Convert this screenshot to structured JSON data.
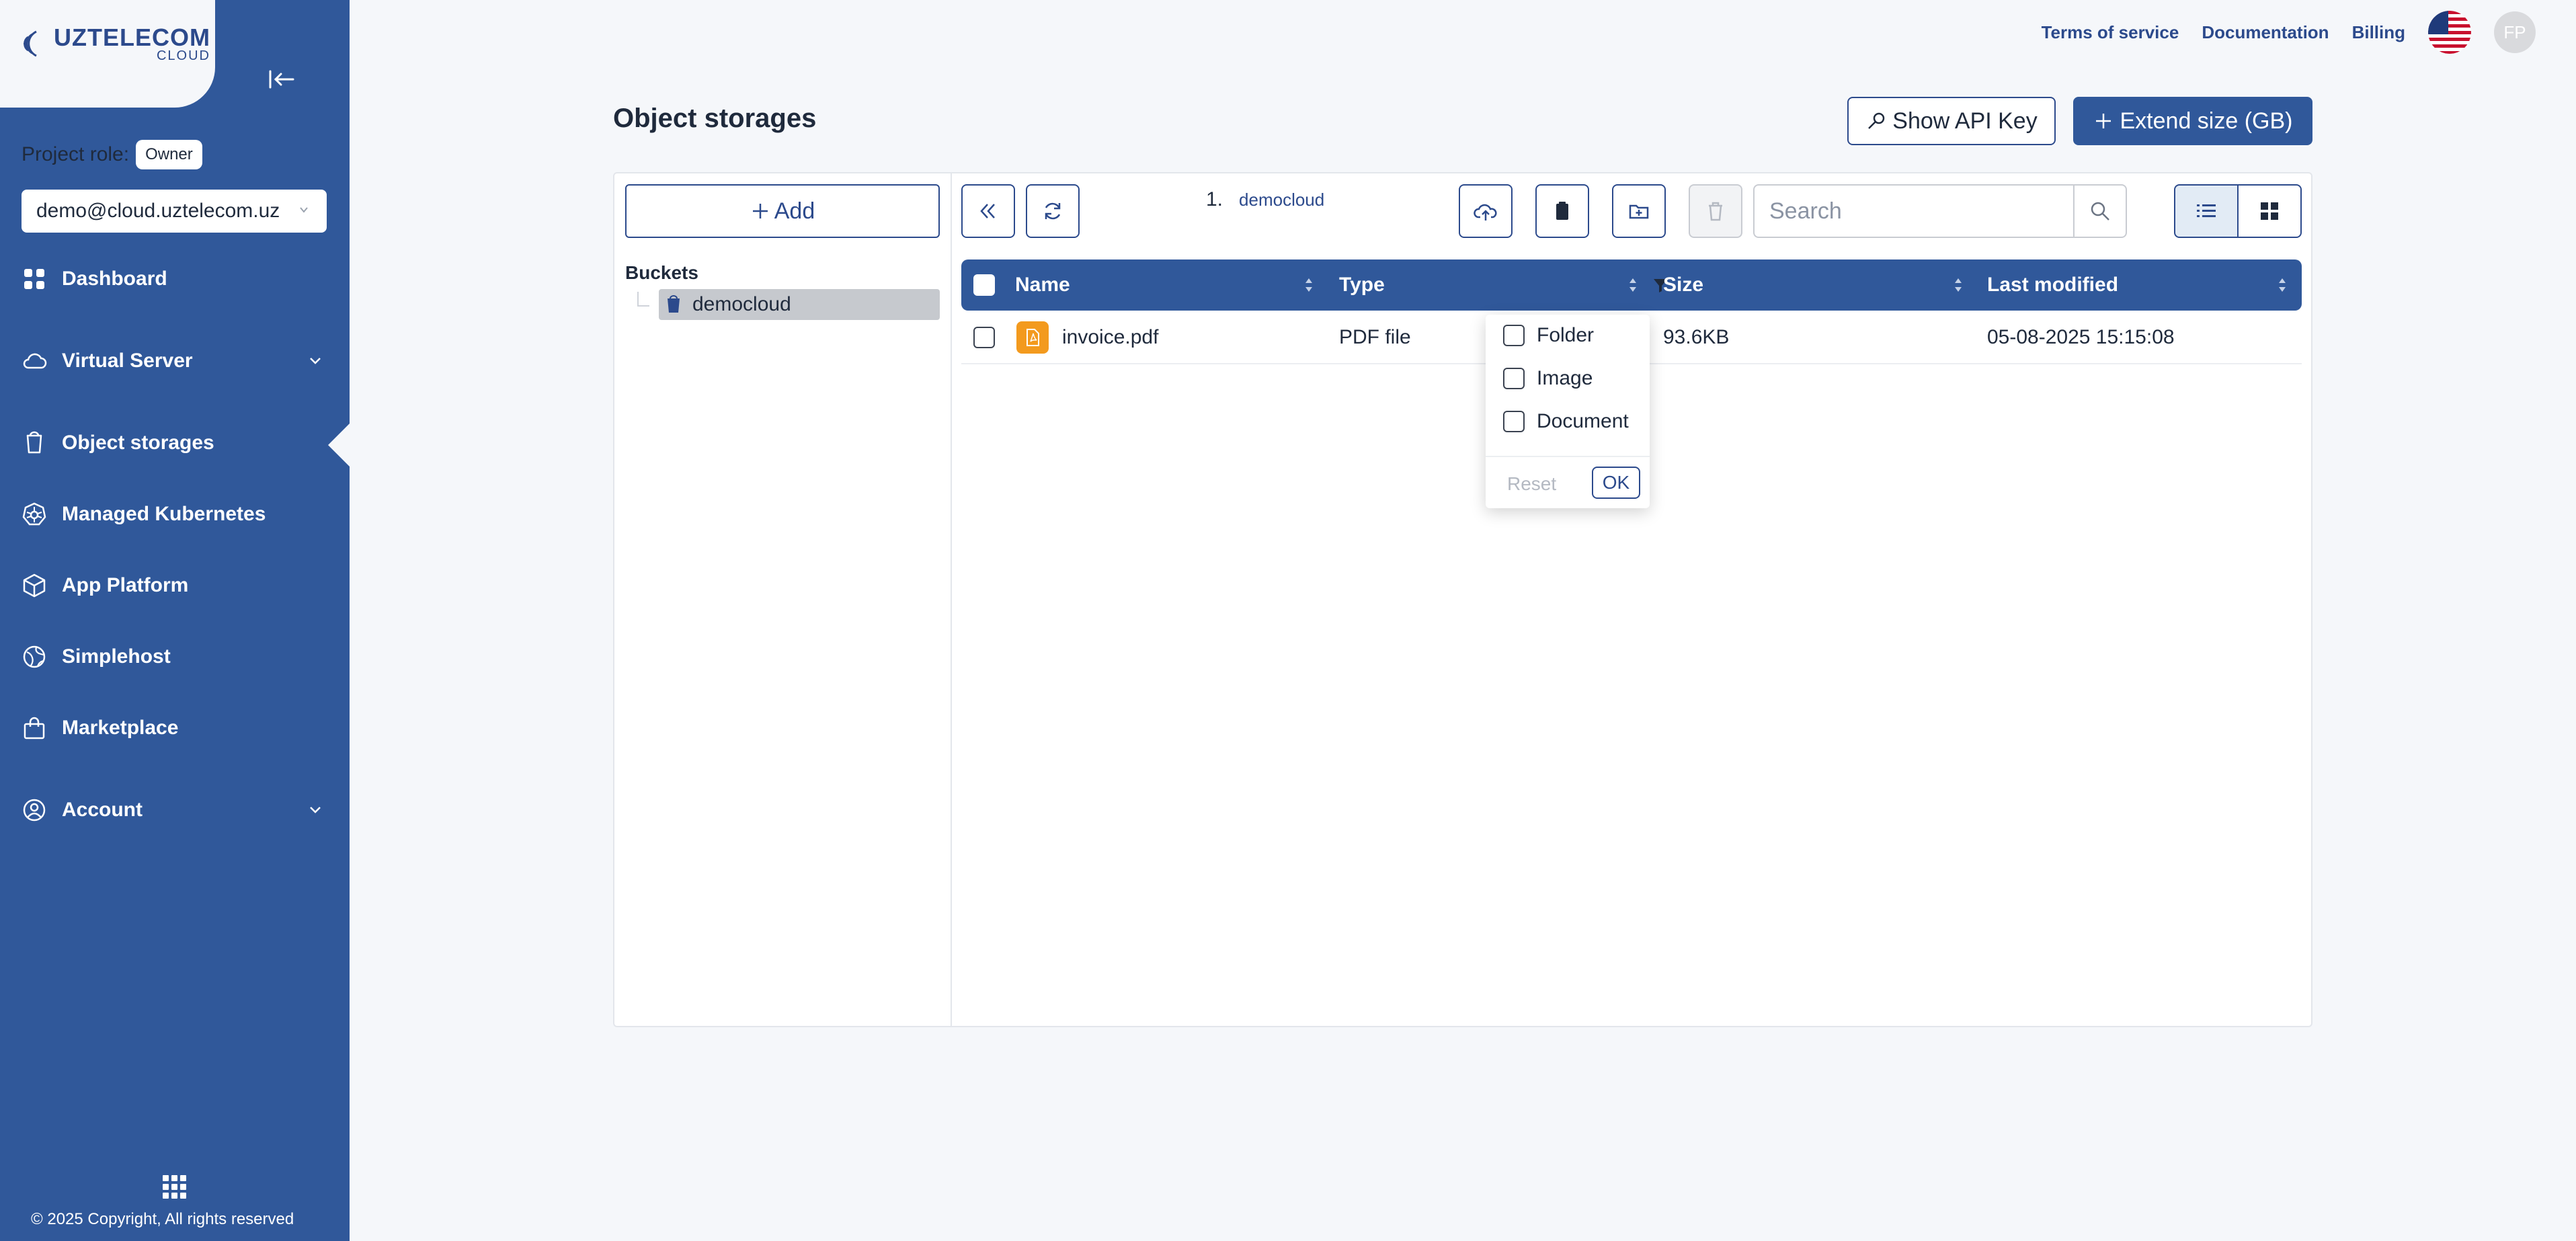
{
  "brand": {
    "name": "UZTELECOM",
    "sub": "CLOUD"
  },
  "sidebar": {
    "project_role_label": "Project role:",
    "project_role_value": "Owner",
    "project_select": "demo@cloud.uztelecom.uz",
    "items": [
      {
        "label": "Dashboard",
        "icon": "dashboard-icon"
      },
      {
        "label": "Virtual Server",
        "icon": "cloud-icon",
        "expandable": true
      },
      {
        "label": "Object storages",
        "icon": "bucket-icon",
        "active": true
      },
      {
        "label": "Managed Kubernetes",
        "icon": "kubernetes-icon"
      },
      {
        "label": "App Platform",
        "icon": "box-icon"
      },
      {
        "label": "Simplehost",
        "icon": "globe-icon"
      },
      {
        "label": "Marketplace",
        "icon": "bag-icon"
      },
      {
        "label": "Account",
        "icon": "user-circle-icon",
        "expandable": true
      }
    ],
    "copyright": "© 2025 Copyright, All rights reserved"
  },
  "topbar": {
    "links": [
      "Terms of service",
      "Documentation",
      "Billing"
    ],
    "avatar_initials": "FP"
  },
  "header": {
    "title": "Object storages",
    "api_key_button": "Show API Key",
    "extend_button": "Extend size (GB)"
  },
  "explorer": {
    "add_button": "Add",
    "buckets_label": "Buckets",
    "buckets": [
      "democloud"
    ],
    "breadcrumb": {
      "number": "1.",
      "label": "democloud"
    },
    "search_placeholder": "Search",
    "columns": [
      "Name",
      "Type",
      "Size",
      "Last modified"
    ],
    "rows": [
      {
        "name": "invoice.pdf",
        "type": "PDF file",
        "size": "93.6KB",
        "modified": "05-08-2025 15:15:08"
      }
    ],
    "type_filter": {
      "options": [
        "Folder",
        "Image",
        "Document"
      ],
      "reset": "Reset",
      "ok": "OK"
    }
  },
  "colors": {
    "primary": "#30589a",
    "accent": "#2c4a8c",
    "pdf": "#f39a1e"
  }
}
